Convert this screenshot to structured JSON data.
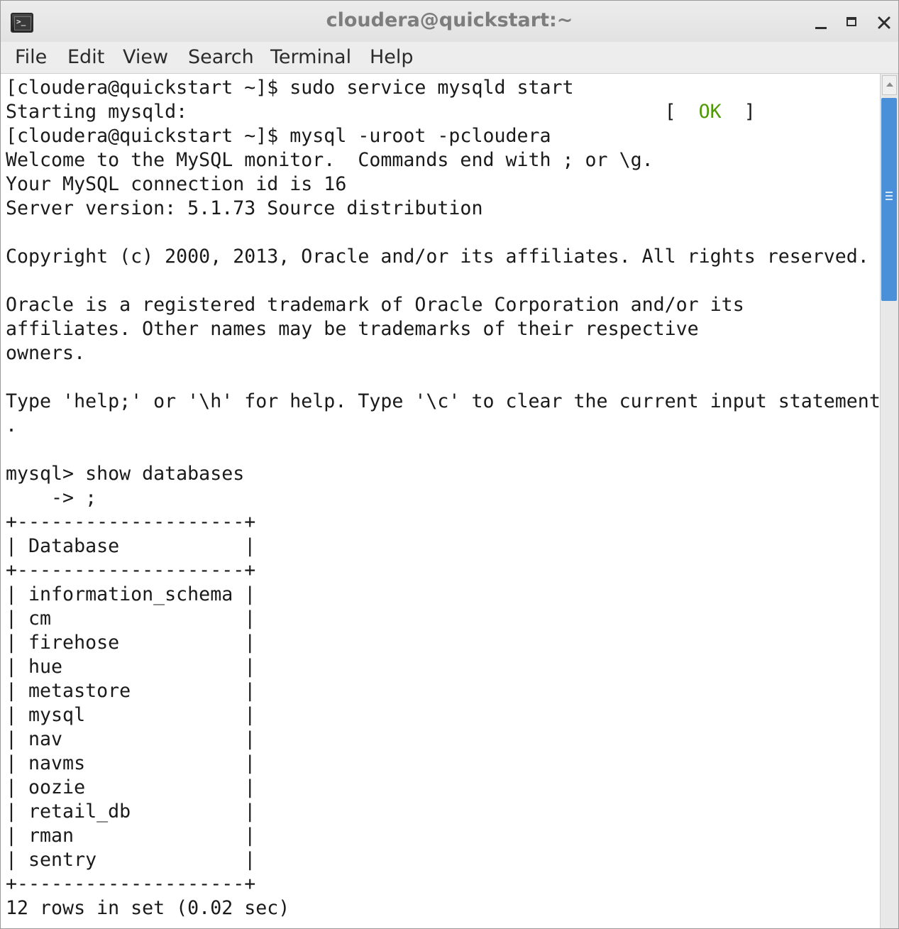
{
  "window": {
    "title": "cloudera@quickstart:~"
  },
  "menubar": {
    "items": [
      "File",
      "Edit",
      "View",
      "Search",
      "Terminal",
      "Help"
    ]
  },
  "terminal": {
    "lines_before_ok": "[cloudera@quickstart ~]$ sudo service mysqld start\nStarting mysqld:                                          [  ",
    "ok_status": "OK",
    "lines_after_ok": "  ]\n[cloudera@quickstart ~]$ mysql -uroot -pcloudera\nWelcome to the MySQL monitor.  Commands end with ; or \\g.\nYour MySQL connection id is 16\nServer version: 5.1.73 Source distribution\n\nCopyright (c) 2000, 2013, Oracle and/or its affiliates. All rights reserved.\n\nOracle is a registered trademark of Oracle Corporation and/or its\naffiliates. Other names may be trademarks of their respective\nowners.\n\nType 'help;' or '\\h' for help. Type '\\c' to clear the current input statement\n.\n\nmysql> show databases\n    -> ;\n+--------------------+\n| Database           |\n+--------------------+\n| information_schema |\n| cm                 |\n| firehose           |\n| hue                |\n| metastore          |\n| mysql              |\n| nav                |\n| navms              |\n| oozie              |\n| retail_db          |\n| rman               |\n| sentry             |\n+--------------------+\n12 rows in set (0.02 sec)"
  },
  "colors": {
    "ok_green": "#4e9a06",
    "scroll_thumb": "#4a90d9",
    "title_text": "#7d7d7d"
  },
  "icons": {
    "app": "terminal-icon",
    "minimize": "minimize-icon",
    "maximize": "maximize-icon",
    "close": "close-icon",
    "scroll_up": "scroll-up-arrow-icon"
  }
}
